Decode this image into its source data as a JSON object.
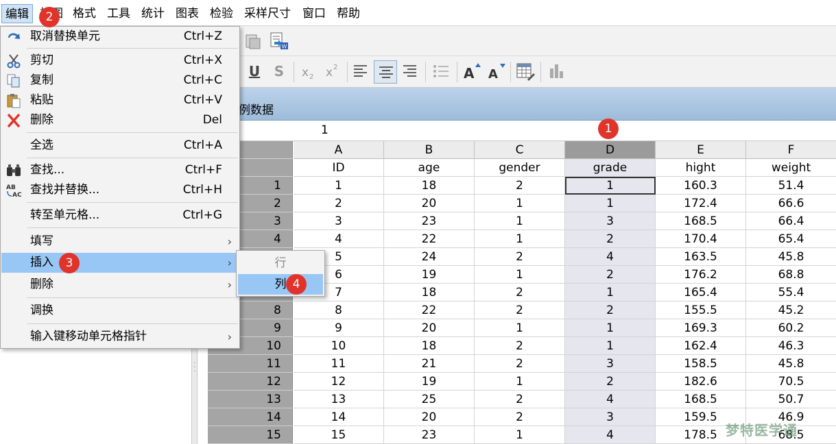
{
  "menubar": {
    "items": [
      "编辑",
      "视图",
      "格式",
      "工具",
      "统计",
      "图表",
      "检验",
      "采样尺寸",
      "窗口",
      "帮助"
    ]
  },
  "sheet": {
    "title": "例数据",
    "content_value": "1"
  },
  "grid": {
    "columns": [
      "A",
      "B",
      "C",
      "D",
      "E",
      "F"
    ],
    "variables": [
      "ID",
      "age",
      "gender",
      "grade",
      "hight",
      "weight"
    ],
    "rows": [
      [
        "1",
        "18",
        "2",
        "1",
        "160.3",
        "51.4"
      ],
      [
        "2",
        "20",
        "1",
        "1",
        "172.4",
        "66.6"
      ],
      [
        "3",
        "23",
        "1",
        "3",
        "168.5",
        "66.4"
      ],
      [
        "4",
        "22",
        "1",
        "2",
        "170.4",
        "65.4"
      ],
      [
        "5",
        "24",
        "2",
        "4",
        "163.5",
        "45.8"
      ],
      [
        "6",
        "19",
        "1",
        "2",
        "176.2",
        "68.8"
      ],
      [
        "7",
        "18",
        "2",
        "1",
        "165.4",
        "55.4"
      ],
      [
        "8",
        "22",
        "2",
        "2",
        "155.5",
        "45.2"
      ],
      [
        "9",
        "20",
        "1",
        "1",
        "169.3",
        "60.2"
      ],
      [
        "10",
        "18",
        "2",
        "1",
        "162.4",
        "46.3"
      ],
      [
        "11",
        "21",
        "2",
        "3",
        "158.5",
        "45.8"
      ],
      [
        "12",
        "19",
        "1",
        "2",
        "182.6",
        "70.5"
      ],
      [
        "13",
        "25",
        "2",
        "4",
        "168.5",
        "50.7"
      ],
      [
        "14",
        "20",
        "2",
        "3",
        "159.5",
        "46.9"
      ],
      [
        "15",
        "23",
        "1",
        "4",
        "178.5",
        "68.5"
      ]
    ],
    "selected_column": "D"
  },
  "edit_menu": {
    "items": [
      {
        "label": "取消替换单元",
        "shortcut": "Ctrl+Z",
        "icon": "undo-icon"
      },
      {
        "label": "剪切",
        "shortcut": "Ctrl+X",
        "icon": "scissors-icon"
      },
      {
        "label": "复制",
        "shortcut": "Ctrl+C",
        "icon": "copy-icon"
      },
      {
        "label": "粘贴",
        "shortcut": "Ctrl+V",
        "icon": "paste-icon"
      },
      {
        "label": "删除",
        "shortcut": "Del",
        "icon": "delete-x-icon"
      },
      {
        "label": "全选",
        "shortcut": "Ctrl+A"
      },
      {
        "label": "查找...",
        "shortcut": "Ctrl+F",
        "icon": "binoculars-icon"
      },
      {
        "label": "查找并替换...",
        "shortcut": "Ctrl+H",
        "icon": "find-replace-icon"
      },
      {
        "label": "转至单元格...",
        "shortcut": "Ctrl+G"
      },
      {
        "label": "填写"
      },
      {
        "label": "插入"
      },
      {
        "label": "删除"
      },
      {
        "label": "调换"
      },
      {
        "label": "输入键移动单元格指针"
      }
    ],
    "highlighted": "插入"
  },
  "insert_submenu": {
    "items": [
      "行",
      "列"
    ],
    "disabled": "行",
    "highlighted": "列"
  },
  "badges": [
    "1",
    "2",
    "3",
    "4"
  ],
  "watermark": "梦特医学通",
  "colors": {
    "menu_highlight": "#99c7f5",
    "badge": "#e0342a",
    "row_header": "#a5a5a5",
    "selected_column": "#e5e6ee"
  }
}
